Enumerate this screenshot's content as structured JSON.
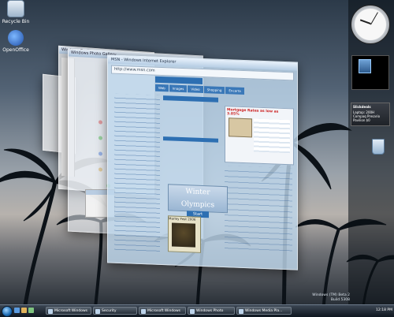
{
  "desktop": {
    "icons": [
      {
        "label": "Recycle Bin"
      },
      {
        "label": "OpenOffice"
      }
    ]
  },
  "front_window": {
    "title": "MSN - Windows Internet Explorer",
    "address": "http://www.msn.com",
    "nav_tabs": [
      "Web",
      "Images",
      "Video",
      "Shopping",
      "Encarta"
    ],
    "ad_title": "Mortgage Rates as low as 3.85%",
    "promo_title": "Winter Olympics",
    "promo_button": "Start",
    "story_title": "Marley Fest 2006"
  },
  "back_windows": [
    {
      "title": "Windows Explorer"
    },
    {
      "title": "Windows Photo Gallery"
    }
  ],
  "sidebar": {
    "feed_title": "Slickdeals",
    "feed_item": "Laptop: 200H Compaq Presario Pavilion $0",
    "bin_label": "Recycle Bin"
  },
  "watermark": {
    "line1": "Windows (TM) Beta 2",
    "line2": "Build 5308"
  },
  "taskbar": {
    "buttons": [
      "Microsoft Windows",
      "Security",
      "Microsoft Windows",
      "Windows Photo",
      "Windows Media Pla..."
    ],
    "time": "12:18 PM"
  }
}
